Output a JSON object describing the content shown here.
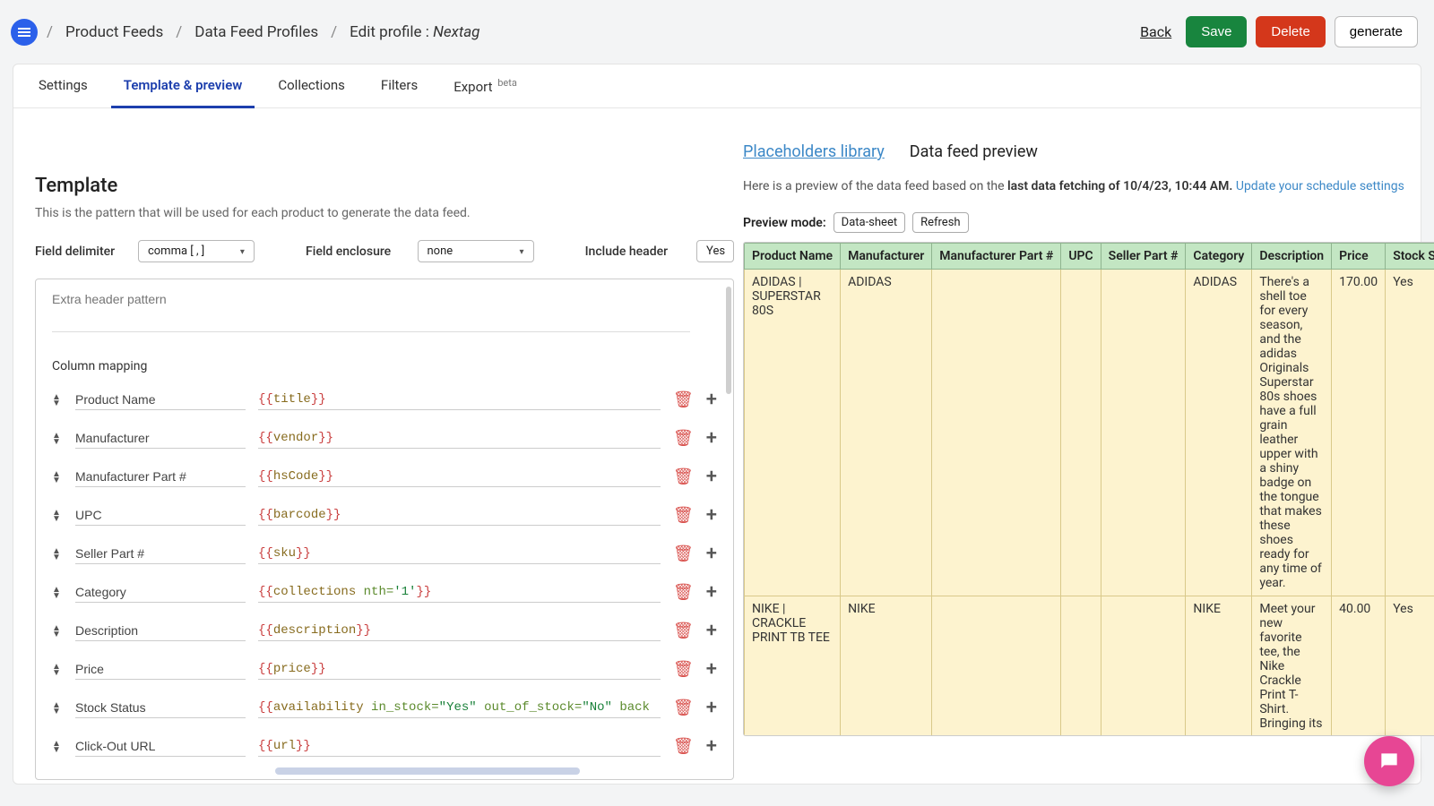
{
  "header": {
    "breadcrumbs": [
      "Product Feeds",
      "Data Feed Profiles"
    ],
    "edit_label": "Edit profile :",
    "profile_name": "Nextag",
    "back": "Back",
    "save": "Save",
    "delete": "Delete",
    "generate": "generate"
  },
  "tabs": {
    "settings": "Settings",
    "template": "Template & preview",
    "collections": "Collections",
    "filters": "Filters",
    "export": "Export",
    "export_badge": "beta"
  },
  "template": {
    "title": "Template",
    "subtitle": "This is the pattern that will be used for each product to generate the data feed.",
    "field_delimiter_label": "Field delimiter",
    "field_delimiter_value": "comma [ , ]",
    "field_enclosure_label": "Field enclosure",
    "field_enclosure_value": "none",
    "include_header_label": "Include header",
    "include_header_value": "Yes",
    "extra_header_placeholder": "Extra header pattern",
    "column_mapping_label": "Column mapping",
    "rows": [
      {
        "name": "Product Name",
        "tokens": [
          [
            "br",
            "{{"
          ],
          [
            "id",
            "title"
          ],
          [
            "br",
            "}}"
          ]
        ]
      },
      {
        "name": "Manufacturer",
        "tokens": [
          [
            "br",
            "{{"
          ],
          [
            "id",
            "vendor"
          ],
          [
            "br",
            "}}"
          ]
        ]
      },
      {
        "name": "Manufacturer Part #",
        "tokens": [
          [
            "br",
            "{{"
          ],
          [
            "id",
            "hsCode"
          ],
          [
            "br",
            "}}"
          ]
        ]
      },
      {
        "name": "UPC",
        "tokens": [
          [
            "br",
            "{{"
          ],
          [
            "id",
            "barcode"
          ],
          [
            "br",
            "}}"
          ]
        ]
      },
      {
        "name": "Seller Part #",
        "tokens": [
          [
            "br",
            "{{"
          ],
          [
            "id",
            "sku"
          ],
          [
            "br",
            "}}"
          ]
        ]
      },
      {
        "name": "Category",
        "tokens": [
          [
            "br",
            "{{"
          ],
          [
            "id",
            "collections"
          ],
          [
            "txt",
            " "
          ],
          [
            "kw",
            "nth="
          ],
          [
            "str",
            "'1'"
          ],
          [
            "br",
            "}}"
          ]
        ]
      },
      {
        "name": "Description",
        "tokens": [
          [
            "br",
            "{{"
          ],
          [
            "id",
            "description"
          ],
          [
            "br",
            "}}"
          ]
        ]
      },
      {
        "name": "Price",
        "tokens": [
          [
            "br",
            "{{"
          ],
          [
            "id",
            "price"
          ],
          [
            "br",
            "}}"
          ]
        ]
      },
      {
        "name": "Stock Status",
        "tokens": [
          [
            "br",
            "{{"
          ],
          [
            "id",
            "availability"
          ],
          [
            "txt",
            " "
          ],
          [
            "kw",
            "in_stock="
          ],
          [
            "str",
            "\"Yes\""
          ],
          [
            "txt",
            " "
          ],
          [
            "kw",
            "out_of_stock="
          ],
          [
            "str",
            "\"No\""
          ],
          [
            "txt",
            " "
          ],
          [
            "kw",
            "back"
          ]
        ]
      },
      {
        "name": "Click-Out URL",
        "tokens": [
          [
            "br",
            "{{"
          ],
          [
            "id",
            "url"
          ],
          [
            "br",
            "}}"
          ]
        ]
      }
    ]
  },
  "preview": {
    "placeholders_link": "Placeholders library",
    "title": "Data feed preview",
    "desc_prefix": "Here is a preview of the data feed based on the ",
    "desc_bold": "last data fetching of 10/4/23, 10:44 AM.",
    "desc_link": "Update your schedule settings",
    "mode_label": "Preview mode:",
    "mode_value": "Data-sheet",
    "refresh": "Refresh",
    "columns": [
      "Product Name",
      "Manufacturer",
      "Manufacturer Part #",
      "UPC",
      "Seller Part #",
      "Category",
      "Description",
      "Price",
      "Stock S"
    ],
    "rows": [
      {
        "cells": [
          "ADIDAS | SUPERSTAR 80S",
          "ADIDAS",
          "",
          "",
          "",
          "ADIDAS",
          "There's a shell toe for every season, and the adidas Originals Superstar 80s shoes have a full grain leather upper with a shiny badge on the tongue that makes these shoes ready for any time of year.",
          "170.00",
          "Yes"
        ]
      },
      {
        "cells": [
          "NIKE | CRACKLE PRINT TB TEE",
          "NIKE",
          "",
          "",
          "",
          "NIKE",
          "Meet your new favorite tee, the Nike Crackle Print T-Shirt. Bringing its",
          "40.00",
          "Yes"
        ]
      }
    ]
  }
}
